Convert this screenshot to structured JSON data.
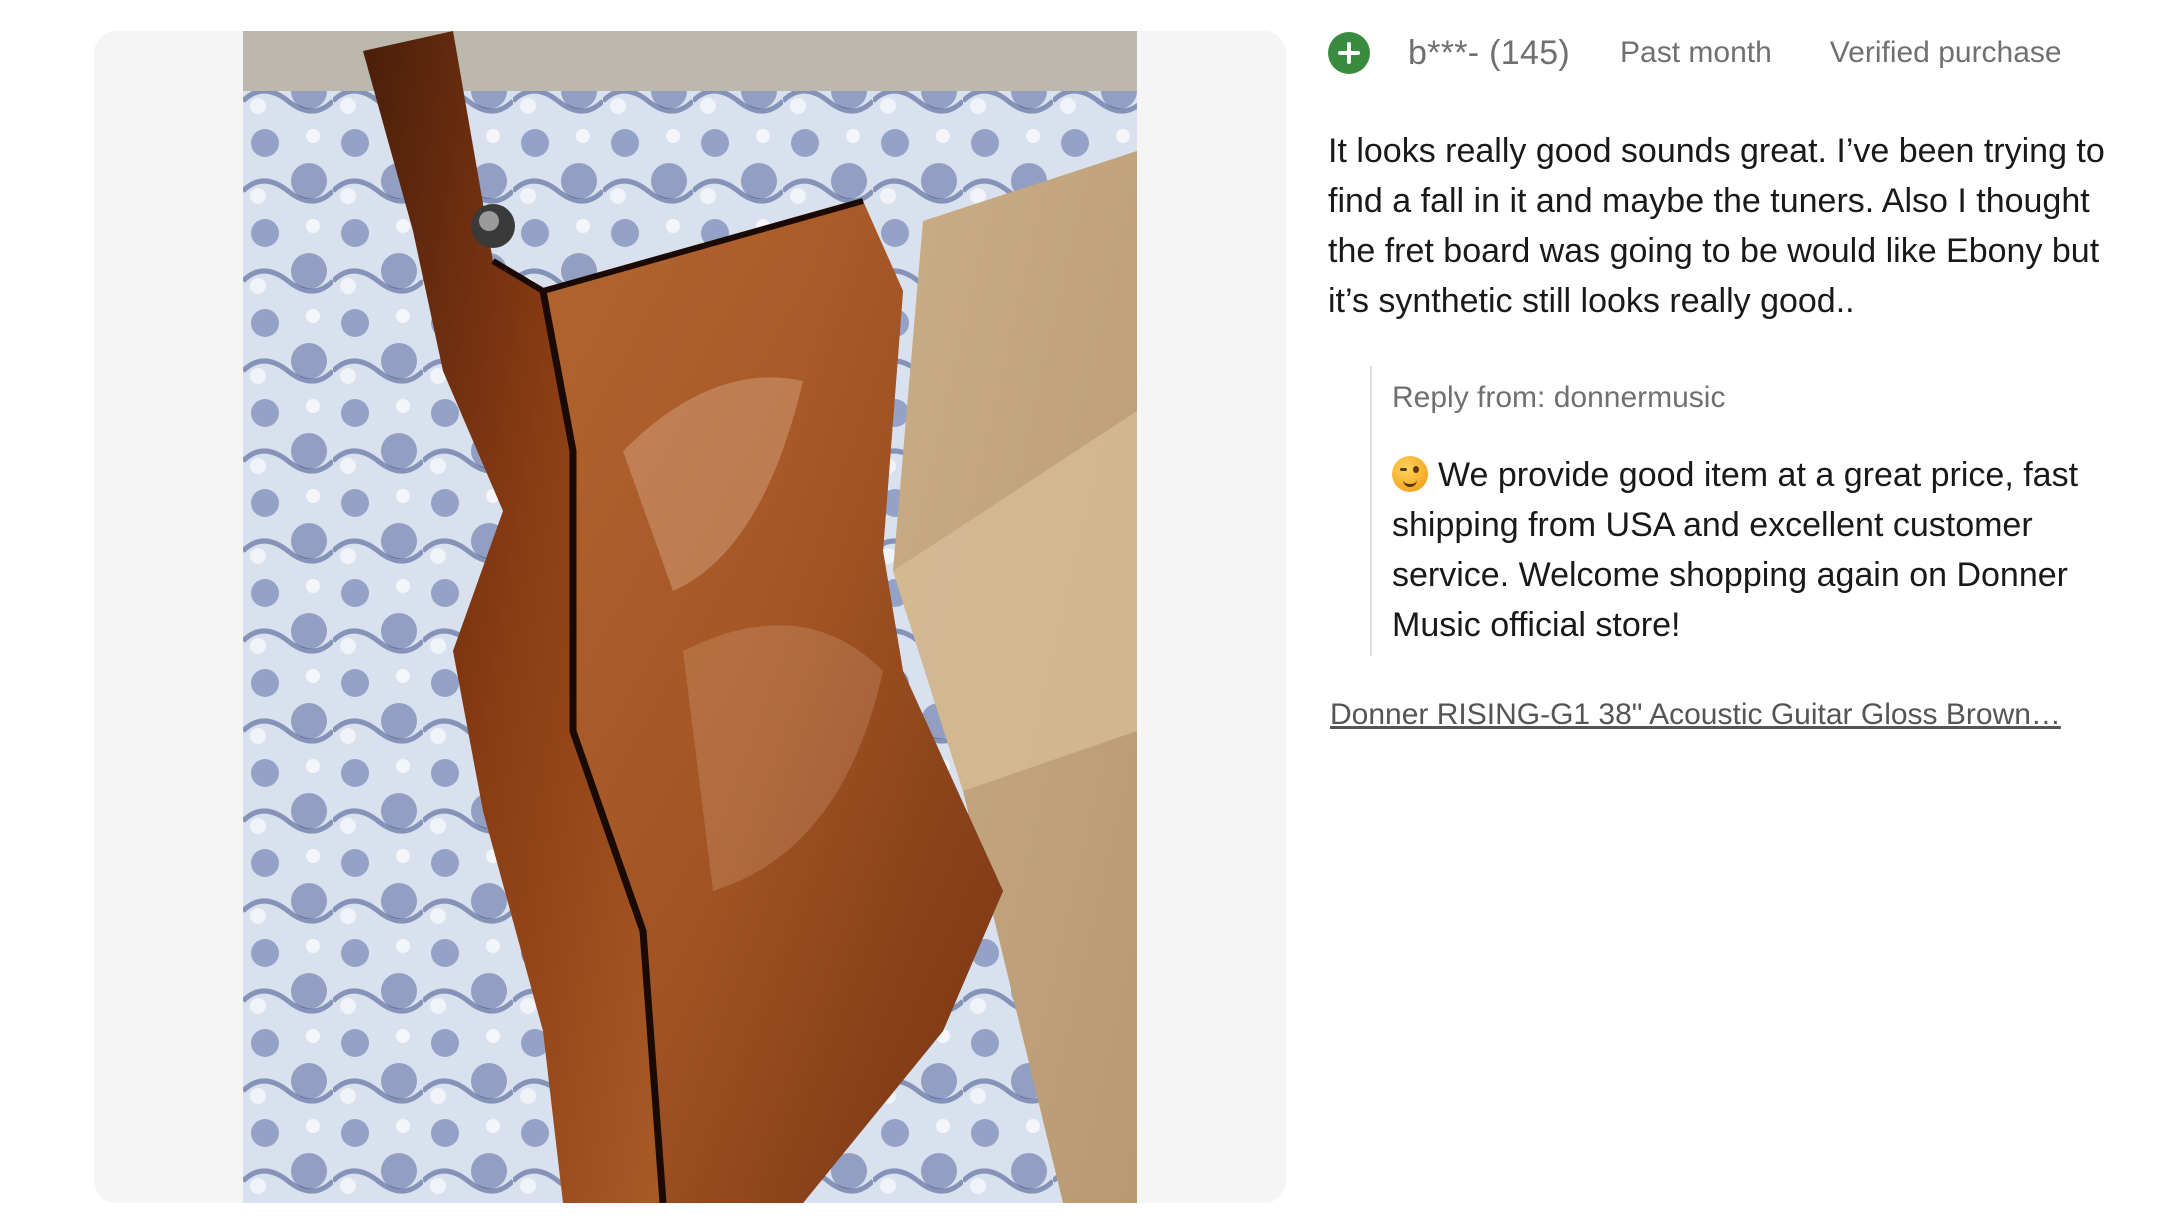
{
  "review": {
    "username": "b***- (145)",
    "date": "Past month",
    "verified": "Verified purchase",
    "text": "It looks really good sounds great. I’ve been trying to find a fall in it and maybe the tuners. Also I thought the fret board was going to be would like Ebony but it’s synthetic still looks really good..",
    "reply": {
      "from": "Reply from: donnermusic",
      "text": "We provide good item at a great price, fast shipping from USA and excellent customer service. Welcome shopping again on Donner Music official store!"
    },
    "product_link": "Donner RISING-G1 38\" Acoustic Guitar Gloss Brown…"
  },
  "colors": {
    "positive_badge": "#3a8b3f",
    "meta_text": "#707070",
    "body_text": "#191919",
    "panel_bg": "#f5f5f5"
  },
  "icons": {
    "rating": "plus-circle-icon",
    "reply_emoji": "wink-smile-emoji-icon"
  }
}
